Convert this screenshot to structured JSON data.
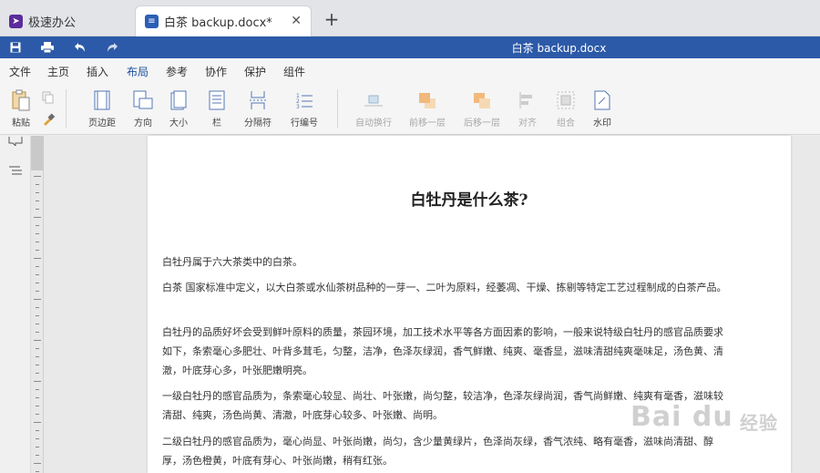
{
  "tabs": [
    {
      "label": "极速办公",
      "icon": "rocket-icon"
    },
    {
      "label": "白茶 backup.docx*",
      "icon": "document-icon"
    }
  ],
  "title_bar": {
    "title": "白茶 backup.docx"
  },
  "menu": [
    "文件",
    "主页",
    "插入",
    "布局",
    "参考",
    "协作",
    "保护",
    "组件"
  ],
  "active_menu": "布局",
  "ribbon": {
    "paste": "粘贴",
    "margins": "页边距",
    "orientation": "方向",
    "size": "大小",
    "columns": "栏",
    "breaks": "分隔符",
    "line_numbers": "行编号",
    "wrap": "自动换行",
    "bring_forward": "前移一层",
    "send_backward": "后移一层",
    "align": "对齐",
    "group": "组合",
    "watermark": "水印"
  },
  "document": {
    "heading": "白牡丹是什么茶?",
    "paragraphs": [
      "白牡丹属于六大茶类中的白茶。",
      "白茶 国家标准中定义，以大白茶或水仙茶树品种的一芽一、二叶为原料，经萎凋、干燥、拣剔等特定工艺过程制成的白茶产品。",
      "白牡丹的品质好坏会受到鲜叶原料的质量，茶园环境，加工技术水平等各方面因素的影响，一般来说特级白牡丹的感官品质要求如下，条索毫心多肥壮、叶背多茸毛，匀整，洁净，色泽灰绿润，香气鲜嫩、纯爽、毫香显，滋味清甜纯爽毫味足，汤色黄、清澈，叶底芽心多，叶张肥嫩明亮。",
      "一级白牡丹的感官品质为，条索毫心较显、尚壮、叶张嫩，尚匀整，较洁净，色泽灰绿尚润，香气尚鲜嫩、纯爽有毫香，滋味较清甜、纯爽，汤色尚黄、清澈，叶底芽心较多、叶张嫩、尚明。",
      "二级白牡丹的感官品质为，毫心尚显、叶张尚嫩，尚匀，含少量黄绿片，色泽尚灰绿，香气浓纯、略有毫香，滋味尚清甜、醇厚，汤色橙黄，叶底有芽心、叶张尚嫩，稍有红张。"
    ]
  },
  "watermark": {
    "text": "Bai du",
    "text2": "经验"
  },
  "colors": {
    "accent": "#2c5aa8",
    "tab_bg": "#e3e4e8"
  }
}
